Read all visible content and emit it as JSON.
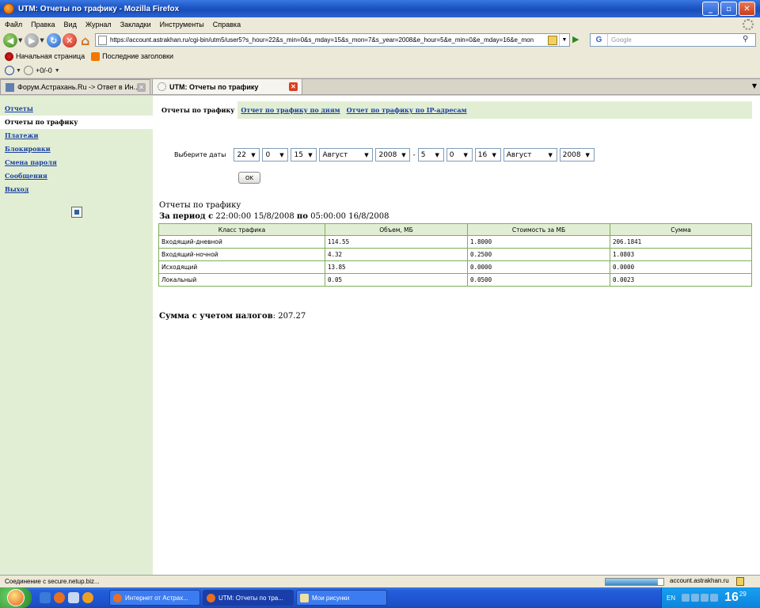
{
  "window": {
    "title": "UTM: Отчеты по трафику - Mozilla Firefox"
  },
  "menu": {
    "items": [
      "Файл",
      "Правка",
      "Вид",
      "Журнал",
      "Закладки",
      "Инструменты",
      "Справка"
    ]
  },
  "navbar": {
    "url": "https://account.astrakhan.ru/cgi-bin/utm5/user5?s_hour=22&s_min=0&s_mday=15&s_mon=7&s_year=2008&e_hour=5&e_min=0&e_mday=16&e_mon",
    "search_placeholder": "Google"
  },
  "bookmarks": [
    "Начальная страница",
    "Последние заголовки"
  ],
  "extbar": {
    "label": "+0/-0"
  },
  "tabs": [
    {
      "label": "Форум.Астрахань.Ru -> Ответ в Ин..."
    },
    {
      "label": "UTM: Отчеты по трафику"
    }
  ],
  "sidebar": {
    "items": [
      "Отчеты",
      "Отчеты по трафику",
      "Платежи",
      "Блокировки",
      "Смена пароля",
      "Сообщения",
      "Выход"
    ]
  },
  "subnav": {
    "items": [
      "Отчеты по трафику",
      "Отчет по трафику по дням",
      "Отчет по трафику по IP-адресам"
    ]
  },
  "datepicker": {
    "label": "Выберите даты",
    "start": {
      "hour": "22",
      "min": "0",
      "day": "15",
      "month": "Август",
      "year": "2008"
    },
    "end": {
      "hour": "5",
      "min": "0",
      "day": "16",
      "month": "Август",
      "year": "2008"
    },
    "separator": "-",
    "ok_label": "OK"
  },
  "report": {
    "title": "Отчеты по трафику",
    "period_prefix": "За период с",
    "period_from": "22:00:00 15/8/2008",
    "period_mid": "по",
    "period_to": "05:00:00 16/8/2008",
    "columns": [
      "Класс трафика",
      "Объем, МБ",
      "Стоимость за МБ",
      "Сумма"
    ],
    "rows": [
      [
        "Входящий-дневной",
        "114.55",
        "1.8000",
        "206.1841"
      ],
      [
        "Входящий-ночной",
        "4.32",
        "0.2500",
        "1.0803"
      ],
      [
        "Исходящий",
        "13.85",
        "0.0000",
        "0.0000"
      ],
      [
        "Локальный",
        "0.05",
        "0.0500",
        "0.0023"
      ]
    ],
    "total_label": "Сумма с учетом налогов",
    "total_value": "207.27"
  },
  "status": {
    "text": "Соединение с secure.netup.biz...",
    "host": "account.astrakhan.ru",
    "progress": 0.9
  },
  "taskbar": {
    "tasks": [
      "Интернет от Астрах...",
      "UTM: Отчеты по тра...",
      "Мои рисунки"
    ],
    "lang": "EN",
    "time_hour": "16",
    "time_min": "29"
  }
}
